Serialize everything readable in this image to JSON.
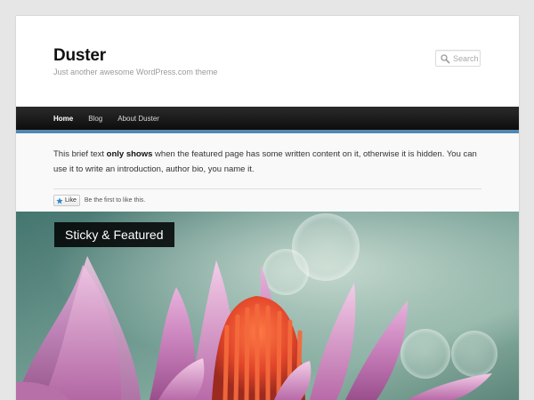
{
  "site": {
    "title": "Duster",
    "tagline": "Just another awesome WordPress.com theme"
  },
  "search": {
    "placeholder": "Search"
  },
  "nav": {
    "items": [
      {
        "label": "Home",
        "active": true
      },
      {
        "label": "Blog",
        "active": false
      },
      {
        "label": "About Duster",
        "active": false
      }
    ]
  },
  "intro": {
    "text_before": "This brief text ",
    "text_bold": "only shows",
    "text_after": " when the featured page has some written content on it, otherwise it is hidden. You can use it to write an introduction, author bio, you name it."
  },
  "like": {
    "button_label": "Like",
    "text": "Be the first to like this."
  },
  "featured": {
    "label": "Sticky & Featured",
    "image": "pink water lily flower on blurred teal background"
  },
  "colors": {
    "nav_accent": "#5387b0",
    "nav_bg": "#111111",
    "page_bg": "#e6e6e6"
  }
}
